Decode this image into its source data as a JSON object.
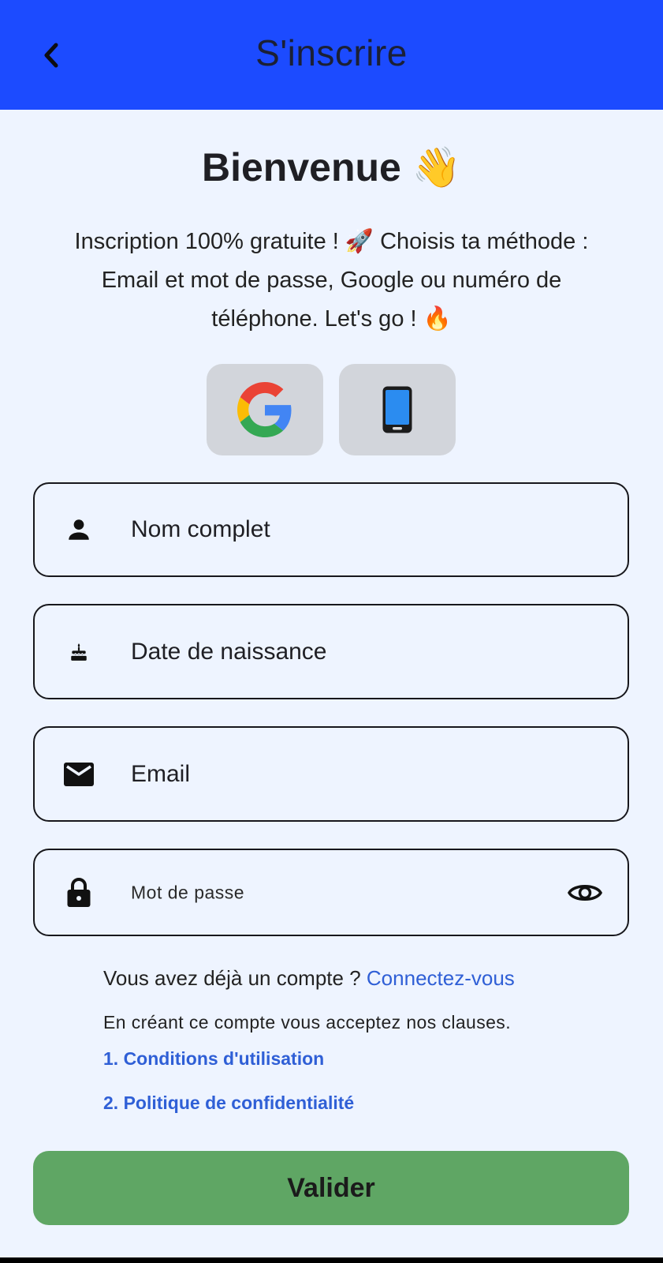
{
  "header": {
    "title": "S'inscrire",
    "back_icon": "chevron-left-icon"
  },
  "welcome": {
    "title": "Bienvenue",
    "emoji": "👋"
  },
  "intro": {
    "line1": "Inscription 100% gratuite ! 🚀 Choisis ta méthode :",
    "line2": "Email et mot de passe, Google ou numéro de",
    "line3": "téléphone. Let's go ! 🔥"
  },
  "social": {
    "google_icon": "google-icon",
    "phone_icon": "mobile-phone-icon"
  },
  "form": {
    "full_name_placeholder": "Nom complet",
    "birthdate_placeholder": "Date de naissance",
    "email_placeholder": "Email",
    "password_placeholder": "Mot de passe"
  },
  "account": {
    "question": "Vous avez déjà un compte ?",
    "login_link": "Connectez-vous"
  },
  "terms": {
    "text": "En créant ce compte vous acceptez nos clauses.",
    "conditions_link": "1. Conditions d'utilisation",
    "privacy_link": "2. Politique de confidentialité"
  },
  "submit": {
    "label": "Valider"
  },
  "colors": {
    "appbar": "#1c4bff",
    "background": "#eef4ff",
    "link": "#2f5fd6",
    "submit": "#5fa664",
    "social_button": "#d2d5db"
  }
}
